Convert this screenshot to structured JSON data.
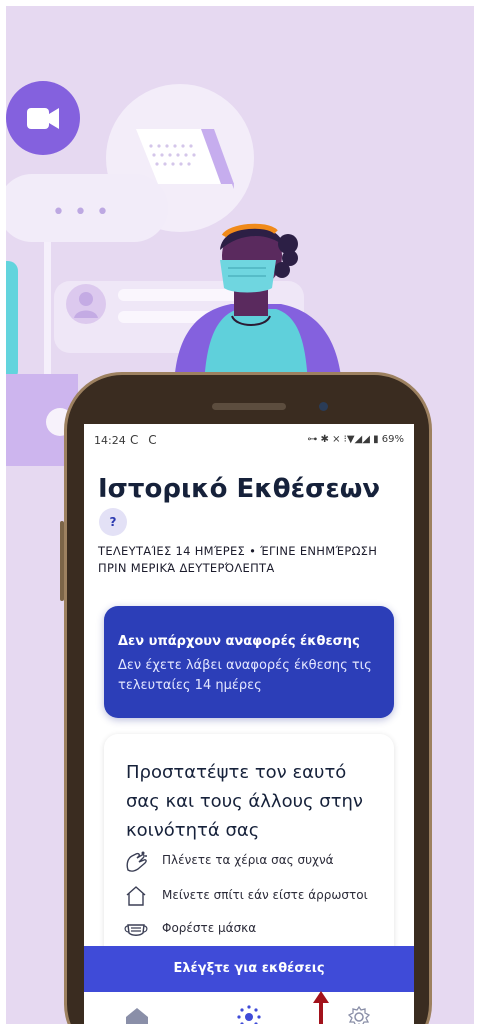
{
  "status_bar": {
    "time": "14:24",
    "sync": "C C",
    "indicators": "⊶ ✱ ⨯ ⁝▼◢◢ ▮ 69%"
  },
  "screen": {
    "title": "Ιστορικό Εκθέσεων",
    "help_label": "?",
    "updated": "ΤΕΛΕΥΤΑΊΕΣ 14 ΗΜΈΡΕΣ • ΈΓΙΝΕ ΕΝΗΜΈΡΩΣΗ ΠΡΙΝ ΜΕΡΙΚΆ ΔΕΥΤΕΡΌΛΕΠΤΑ"
  },
  "no_reports_card": {
    "title": "Δεν υπάρχουν αναφορές έκθεσης",
    "text": "Δεν έχετε λάβει αναφορές έκθεσης τις τελευταίες 14 ημέρες"
  },
  "protect_card": {
    "title": "Προστατέψτε τον εαυτό σας και τους άλλους στην κοινότητά σας",
    "tips": [
      {
        "icon": "hand-wash-icon",
        "label": "Πλένετε τα χέρια σας συχνά"
      },
      {
        "icon": "home-icon",
        "label": "Μείνετε σπίτι εάν είστε άρρωστοι"
      },
      {
        "icon": "mask-icon",
        "label": "Φορέστε μάσκα"
      }
    ]
  },
  "cta_label": "Ελέγξτε για εκθέσεις",
  "bottom_nav": [
    {
      "icon": "home-icon"
    },
    {
      "icon": "exposure-icon"
    },
    {
      "icon": "settings-icon"
    }
  ],
  "colors": {
    "background": "#e6d9f1",
    "primary": "#2c3eb8",
    "cta": "#3f4bd8",
    "illustration_purple": "#8461de",
    "arrow": "#a2121b"
  }
}
